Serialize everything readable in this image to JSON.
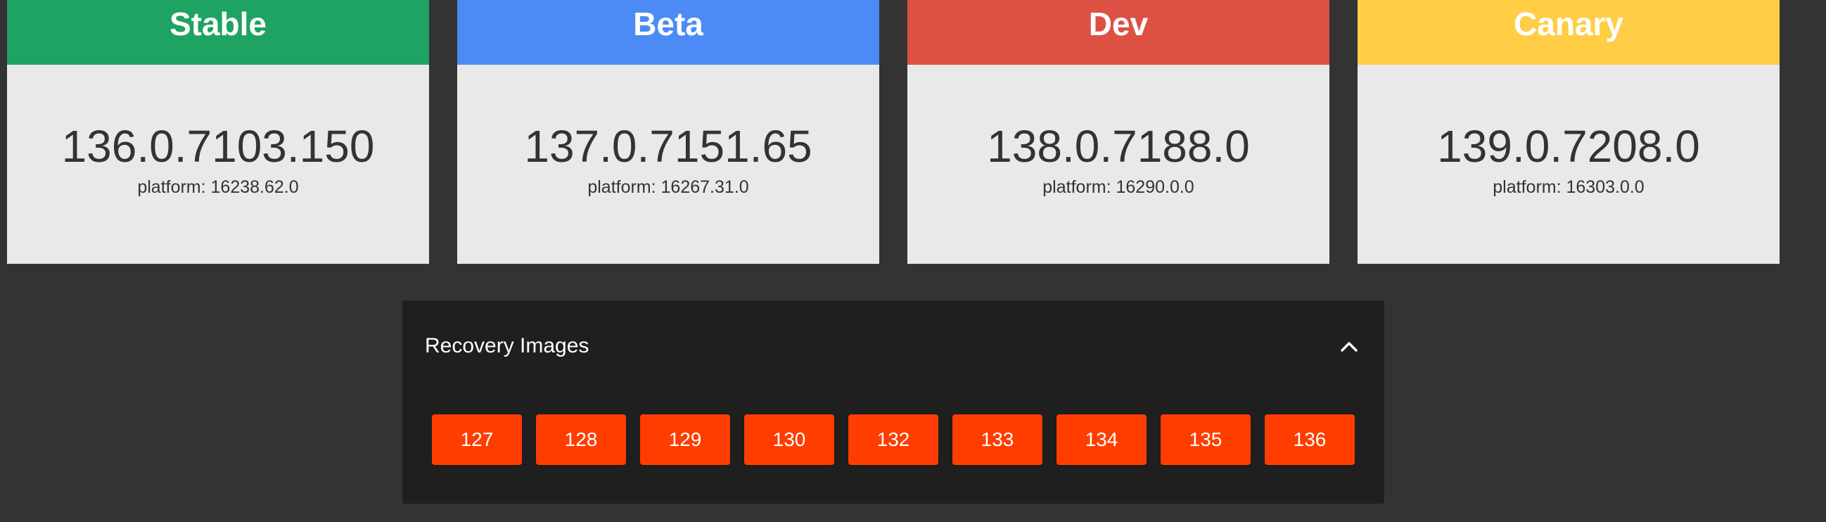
{
  "channels": [
    {
      "name": "Stable",
      "version": "136.0.7103.150",
      "platform": "platform: 16238.62.0",
      "color": "#1ea362"
    },
    {
      "name": "Beta",
      "version": "137.0.7151.65",
      "platform": "platform: 16267.31.0",
      "color": "#4c8bf5"
    },
    {
      "name": "Dev",
      "version": "138.0.7188.0",
      "platform": "platform: 16290.0.0",
      "color": "#dd5144"
    },
    {
      "name": "Canary",
      "version": "139.0.7208.0",
      "platform": "platform: 16303.0.0",
      "color": "#ffcd46"
    }
  ],
  "recovery": {
    "title": "Recovery Images",
    "expanded": true,
    "collapse_icon": "chevron-up-icon",
    "buttons": [
      "127",
      "128",
      "129",
      "130",
      "132",
      "133",
      "134",
      "135",
      "136"
    ],
    "button_color": "#ff3d00"
  }
}
